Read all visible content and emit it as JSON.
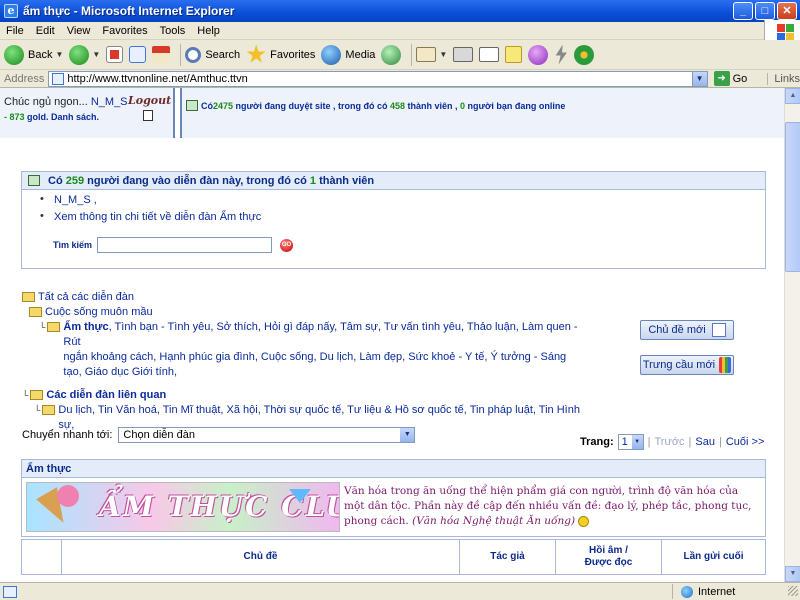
{
  "window": {
    "title": "ẩm thực - Microsoft Internet Explorer",
    "minimize": "_",
    "maximize": "□",
    "close": "✕"
  },
  "menu": [
    "File",
    "Edit",
    "View",
    "Favorites",
    "Tools",
    "Help"
  ],
  "toolbar": {
    "back": "Back",
    "search": "Search",
    "favorites": "Favorites",
    "media": "Media"
  },
  "address": {
    "label": "Address",
    "url": "http://www.ttvnonline.net/Amthuc.ttvn",
    "go": "Go",
    "links": "Links"
  },
  "header": {
    "greeting": "Chúc ngủ ngon... ",
    "username": "N_M_S",
    "logout": "Logout",
    "gold_prefix": "- ",
    "gold_amount": "873",
    "gold_suffix": " gold. Danh sách.",
    "online_prefix": "Có ",
    "online_count": "2475",
    "online_mid": " người đang duyệt site , trong đó có ",
    "member_count": "458",
    "member_mid": " thành viên , ",
    "friend_count": "0",
    "friend_suffix": " người bạn đang online"
  },
  "who": {
    "prefix": "Có ",
    "count": "259",
    "mid": " người đang vào diễn đàn này, trong đó có ",
    "members": "1",
    "suffix": " thành viên",
    "users": "N_M_S ,",
    "details": "Xem thông tin chi tiết về diễn đàn Ẩm thực",
    "search_label": "Tìm kiếm",
    "search_value": "",
    "go": "GO"
  },
  "tree": {
    "all": "Tất cả các diễn đàn",
    "cat1": "Cuộc sống muôn mầu",
    "forum1_name": "Ẩm thực",
    "forum1_rest_line1": ", Tình bạn - Tình yêu, Sở thích, Hỏi gì đáp nấy, Tâm sự, Tư vấn tình yêu, Thảo luận, Làm quen - Rút",
    "forum1_rest_line2": "ngắn khoảng cách, Hạnh phúc gia đình, Cuộc sống, Du lịch, Làm đẹp, Sức khoẻ - Y tế, Ý tưởng - Sáng",
    "forum1_rest_line3": "tạo, Giáo dục Giới tính,",
    "cat2": "Các diễn đàn liên quan",
    "forum2": "Du lịch, Tin Văn hoá, Tin Mĩ thuật, Xã hội, Thời sự quốc tế, Tư liệu & Hồ sơ quốc tế, Tin pháp luật, Tin Hình sự,"
  },
  "buttons": {
    "new_topic": "Chủ đề mới",
    "new_poll": "Trưng cầu mới"
  },
  "jump": {
    "label": "Chuyển nhanh tới:",
    "selected": "Chọn diễn đàn"
  },
  "pager": {
    "label": "Trang:",
    "current": "1",
    "prev": "Trước",
    "next": "Sau",
    "last": "Cuối >>"
  },
  "forum": {
    "title": "Ẩm thực",
    "banner_text": "ẨM THỰC CLUB",
    "desc_line1": "Văn hóa trong ăn uống thể hiện phẩm giá con người, trình độ văn hóa của một dân tộc.",
    "desc_line2": "Phần này đề cập đến nhiều vấn đề: đạo lý, phép tắc, phong tục, phong cách. ",
    "desc_quote1": "(Văn hóa",
    "desc_quote2": "Nghệ thuật Ăn uống)"
  },
  "table": {
    "col_topic": "Chủ đề",
    "col_author": "Tác giả",
    "col_replies_1": "Hồi âm /",
    "col_replies_2": "Được đọc",
    "col_last": "Lần gửi cuối"
  },
  "status": {
    "zone": "Internet"
  },
  "colors": {
    "link_blue": "#0a2a9a",
    "count_green": "#1a8a1a",
    "desc_purple": "#7a1a6a",
    "xp_title_blue": "#0a4fd8"
  }
}
